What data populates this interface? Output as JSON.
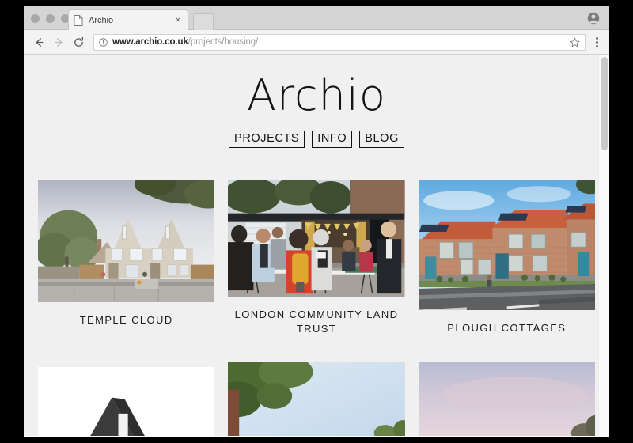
{
  "browser": {
    "tab": {
      "title": "Archio",
      "favicon_icon": "page-icon",
      "close_icon": "close-icon"
    },
    "new_tab_icon": "new-tab-icon",
    "profile_icon": "account-avatar-icon",
    "toolbar": {
      "back_icon": "back-arrow-icon",
      "forward_icon": "forward-arrow-icon",
      "reload_icon": "reload-icon",
      "site_info_icon": "info-circle-icon",
      "bookmark_icon": "star-icon",
      "menu_icon": "three-dot-menu-icon",
      "url_host": "www.archio.co.uk",
      "url_path": "/projects/housing/"
    },
    "window_controls": [
      "close",
      "minimize",
      "zoom"
    ]
  },
  "page": {
    "logo": "Archio",
    "nav": [
      {
        "label": "PROJECTS"
      },
      {
        "label": "INFO"
      },
      {
        "label": "BLOG"
      }
    ],
    "projects_row1": [
      {
        "title": "TEMPLE CLOUD",
        "thumb_height": 155,
        "scene": "temple-cloud"
      },
      {
        "title": "LONDON COMMUNITY LAND TRUST",
        "thumb_height": 148,
        "scene": "london-clt"
      },
      {
        "title": "PLOUGH COTTAGES",
        "thumb_height": 165,
        "scene": "plough-cottages"
      }
    ],
    "projects_row2": [
      {
        "title": "",
        "scene": "dark-roof-white"
      },
      {
        "title": "",
        "scene": "tree-sky"
      },
      {
        "title": "",
        "scene": "pink-sky"
      }
    ],
    "scrollbar": {
      "position": "top"
    }
  },
  "colors": {
    "page_background": "#f0f0f0",
    "toolbar_background": "#f3f3f3",
    "tabstrip_background": "#d4d4d4",
    "text_primary": "#131313",
    "url_host": "#2b2b2b",
    "url_path": "#9a9a9a",
    "scrollbar_thumb": "#c9c9c9"
  }
}
